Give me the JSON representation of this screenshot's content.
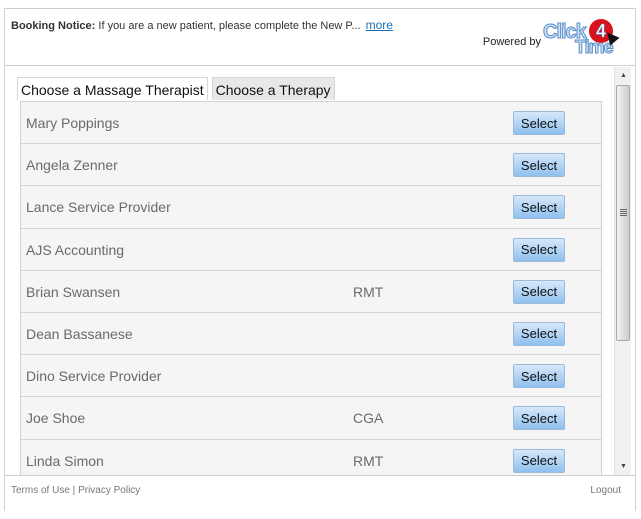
{
  "header": {
    "notice_label": "Booking Notice:",
    "notice_text": " If you are a new patient, please complete the New P...",
    "more_link": "more",
    "powered_by": "Powered by",
    "logo": {
      "click": "Click",
      "four": "4",
      "time": "Time"
    }
  },
  "tabs": [
    {
      "label": "Choose a Massage Therapist",
      "active": true
    },
    {
      "label": "Choose a Therapy",
      "active": false
    }
  ],
  "providers": [
    {
      "name": "Mary Poppings",
      "credential": "",
      "button": "Select"
    },
    {
      "name": "Angela Zenner",
      "credential": "",
      "button": "Select"
    },
    {
      "name": "Lance Service Provider",
      "credential": "",
      "button": "Select"
    },
    {
      "name": "AJS Accounting",
      "credential": "",
      "button": "Select"
    },
    {
      "name": "Brian Swansen",
      "credential": "RMT",
      "button": "Select"
    },
    {
      "name": "Dean Bassanese",
      "credential": "",
      "button": "Select"
    },
    {
      "name": "Dino Service Provider",
      "credential": "",
      "button": "Select"
    },
    {
      "name": "Joe Shoe",
      "credential": "CGA",
      "button": "Select"
    },
    {
      "name": "Linda Simon",
      "credential": "RMT",
      "button": "Select"
    }
  ],
  "scrollbar": {
    "up_icon": "▲",
    "down_icon": "▼"
  },
  "footer": {
    "terms": "Terms of Use",
    "separator": " | ",
    "privacy": "Privacy Policy",
    "logout": "Logout"
  },
  "colors": {
    "link": "#1a6fb0",
    "logo_red": "#d8121b",
    "button_top": "#d6e8fb",
    "button_bottom": "#8fc0ee"
  }
}
